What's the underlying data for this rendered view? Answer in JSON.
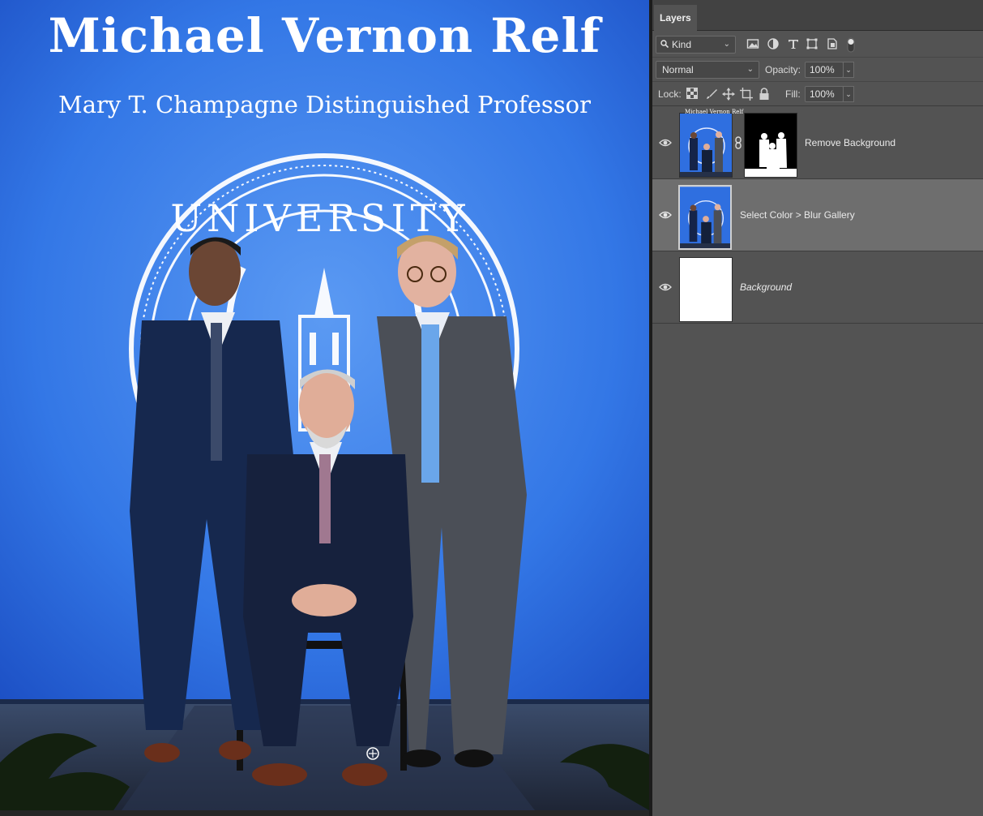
{
  "document": {
    "title": "Michael Vernon Relf",
    "subtitle": "Mary T. Champagne Distinguished Professor",
    "seal_text": "UNIVERSITY",
    "thumb_title": "Michael Vernon Relf"
  },
  "layers_panel": {
    "tab_label": "Layers",
    "filter": {
      "kind_label": "Kind",
      "icons": [
        "image-filter-icon",
        "adjustment-filter-icon",
        "type-filter-icon",
        "shape-filter-icon",
        "smart-object-filter-icon",
        "filter-toggle-icon"
      ]
    },
    "blend_mode": "Normal",
    "opacity_label": "Opacity:",
    "opacity_value": "100%",
    "lock_label": "Lock:",
    "lock_icons": [
      "lock-transparent-pixels-icon",
      "lock-image-pixels-icon",
      "lock-position-icon",
      "lock-artboard-icon",
      "lock-all-icon"
    ],
    "fill_label": "Fill:",
    "fill_value": "100%",
    "layers": [
      {
        "name": "Remove Background",
        "visible": true,
        "has_mask": true,
        "italic": false,
        "selected": false
      },
      {
        "name": "Select Color > Blur Gallery",
        "visible": true,
        "has_mask": false,
        "italic": false,
        "selected": true
      },
      {
        "name": "Background",
        "visible": true,
        "has_mask": false,
        "italic": true,
        "selected": false
      }
    ]
  },
  "colors": {
    "panel_bg": "#535353",
    "selected_row": "#6e6e6e",
    "backdrop_blue": "#3d7de8"
  }
}
